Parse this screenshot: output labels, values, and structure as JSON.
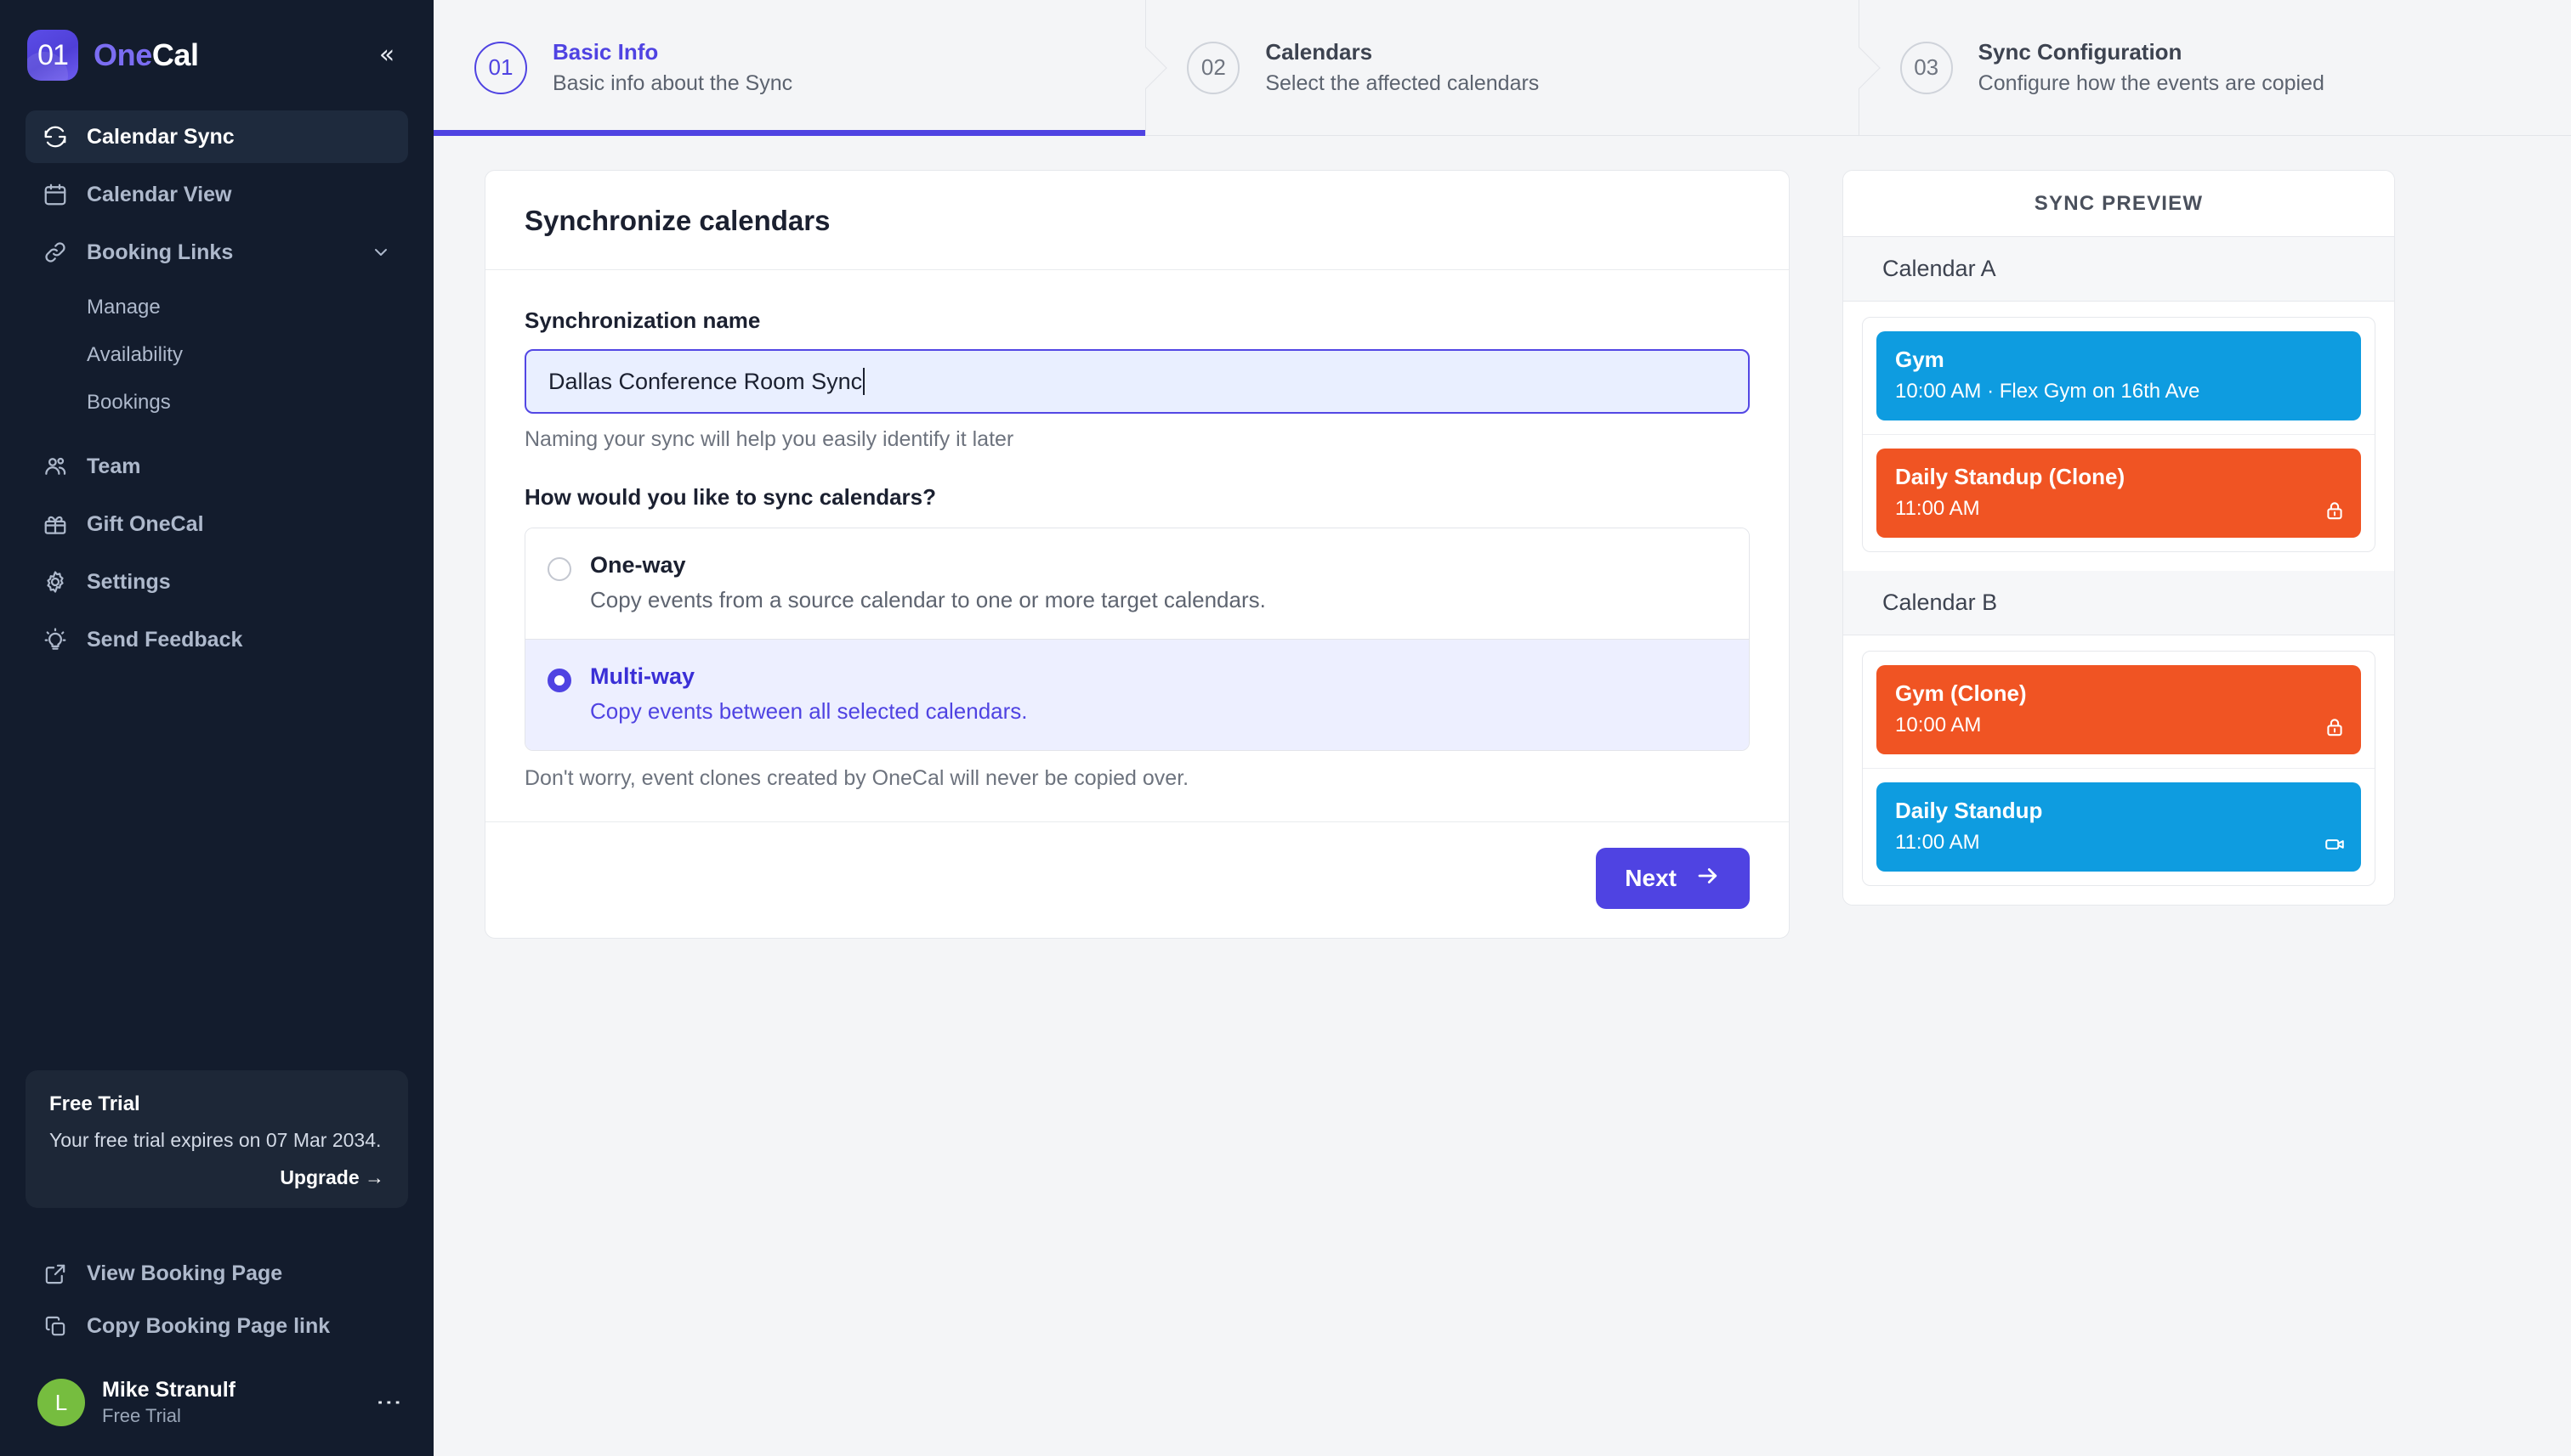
{
  "brand": {
    "mark": "01",
    "name_one": "One",
    "name_cal": "Cal",
    "collapse_icon": "«"
  },
  "sidebar": {
    "nav": [
      {
        "label": "Calendar Sync",
        "icon": "sync-icon",
        "active": true
      },
      {
        "label": "Calendar View",
        "icon": "calendar-icon",
        "active": false
      },
      {
        "label": "Booking Links",
        "icon": "link-icon",
        "active": false,
        "expandable": true
      }
    ],
    "sub_items": [
      {
        "label": "Manage"
      },
      {
        "label": "Availability"
      },
      {
        "label": "Bookings"
      }
    ],
    "nav2": [
      {
        "label": "Team",
        "icon": "users-icon"
      },
      {
        "label": "Gift OneCal",
        "icon": "gift-icon"
      },
      {
        "label": "Settings",
        "icon": "gear-icon"
      },
      {
        "label": "Send Feedback",
        "icon": "lightbulb-icon"
      }
    ],
    "trial": {
      "title": "Free Trial",
      "text": "Your free trial expires on 07 Mar 2034.",
      "upgrade_label": "Upgrade →"
    },
    "links": [
      {
        "label": "View Booking Page",
        "icon": "external-link-icon"
      },
      {
        "label": "Copy Booking Page link",
        "icon": "copy-icon"
      }
    ],
    "user": {
      "avatar_initial": "L",
      "name": "Mike Stranulf",
      "plan": "Free Trial",
      "more_icon": "⋮"
    }
  },
  "stepper": [
    {
      "number": "01",
      "title": "Basic Info",
      "subtitle": "Basic info about the Sync",
      "active": true
    },
    {
      "number": "02",
      "title": "Calendars",
      "subtitle": "Select the affected calendars",
      "active": false
    },
    {
      "number": "03",
      "title": "Sync Configuration",
      "subtitle": "Configure how the events are copied",
      "active": false
    }
  ],
  "form": {
    "title": "Synchronize calendars",
    "name_label": "Synchronization name",
    "name_value": "Dallas Conference Room Sync",
    "name_placeholder": "Synchronization name",
    "name_hint": "Naming your sync will help you easily identify it later",
    "question": "How would you like to sync calendars?",
    "options": [
      {
        "title": "One-way",
        "description": "Copy events from a source calendar to one or more target calendars.",
        "selected": false
      },
      {
        "title": "Multi-way",
        "description": "Copy events between all selected calendars.",
        "selected": true
      }
    ],
    "note": "Don't worry, event clones created by OneCal will never be copied over.",
    "next_label": "Next"
  },
  "preview": {
    "heading": "SYNC PREVIEW",
    "calendars": [
      {
        "name": "Calendar A",
        "events": [
          {
            "title": "Gym",
            "time": "10:00 AM",
            "detail": "10:00 AM · Flex Gym on 16th Ave",
            "color": "blue",
            "badge": ""
          },
          {
            "title": "Daily Standup (Clone)",
            "time": "11:00 AM",
            "detail": "11:00 AM",
            "color": "orange",
            "badge": "lock-icon"
          }
        ]
      },
      {
        "name": "Calendar B",
        "events": [
          {
            "title": "Gym (Clone)",
            "time": "10:00 AM",
            "detail": "10:00 AM",
            "color": "orange",
            "badge": "lock-icon"
          },
          {
            "title": "Daily Standup",
            "time": "11:00 AM",
            "detail": "11:00 AM",
            "color": "blue",
            "badge": "video-icon"
          }
        ]
      }
    ]
  },
  "colors": {
    "accent": "#4f43e2",
    "sidebar_bg": "#131c2d",
    "event_blue": "#0e9ce0",
    "event_orange": "#f05423",
    "avatar_green": "#76bd3f"
  }
}
